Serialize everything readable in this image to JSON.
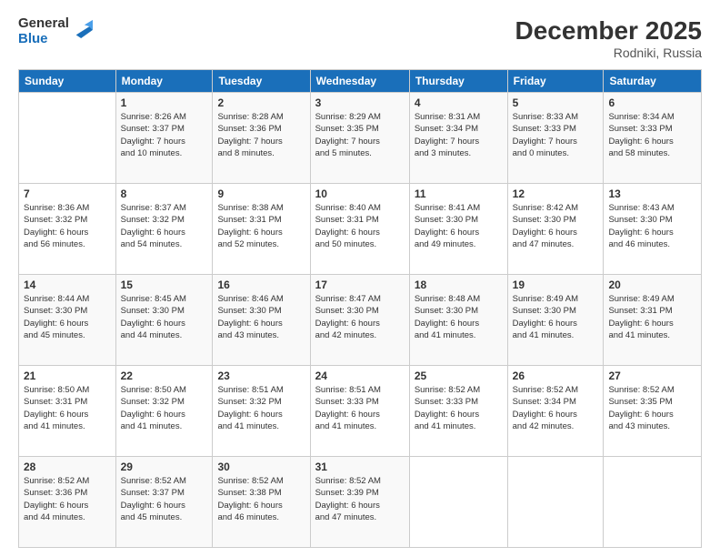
{
  "header": {
    "logo_general": "General",
    "logo_blue": "Blue",
    "month": "December 2025",
    "location": "Rodniki, Russia"
  },
  "days_of_week": [
    "Sunday",
    "Monday",
    "Tuesday",
    "Wednesday",
    "Thursday",
    "Friday",
    "Saturday"
  ],
  "weeks": [
    [
      {
        "day": "",
        "info": ""
      },
      {
        "day": "1",
        "info": "Sunrise: 8:26 AM\nSunset: 3:37 PM\nDaylight: 7 hours\nand 10 minutes."
      },
      {
        "day": "2",
        "info": "Sunrise: 8:28 AM\nSunset: 3:36 PM\nDaylight: 7 hours\nand 8 minutes."
      },
      {
        "day": "3",
        "info": "Sunrise: 8:29 AM\nSunset: 3:35 PM\nDaylight: 7 hours\nand 5 minutes."
      },
      {
        "day": "4",
        "info": "Sunrise: 8:31 AM\nSunset: 3:34 PM\nDaylight: 7 hours\nand 3 minutes."
      },
      {
        "day": "5",
        "info": "Sunrise: 8:33 AM\nSunset: 3:33 PM\nDaylight: 7 hours\nand 0 minutes."
      },
      {
        "day": "6",
        "info": "Sunrise: 8:34 AM\nSunset: 3:33 PM\nDaylight: 6 hours\nand 58 minutes."
      }
    ],
    [
      {
        "day": "7",
        "info": "Sunrise: 8:36 AM\nSunset: 3:32 PM\nDaylight: 6 hours\nand 56 minutes."
      },
      {
        "day": "8",
        "info": "Sunrise: 8:37 AM\nSunset: 3:32 PM\nDaylight: 6 hours\nand 54 minutes."
      },
      {
        "day": "9",
        "info": "Sunrise: 8:38 AM\nSunset: 3:31 PM\nDaylight: 6 hours\nand 52 minutes."
      },
      {
        "day": "10",
        "info": "Sunrise: 8:40 AM\nSunset: 3:31 PM\nDaylight: 6 hours\nand 50 minutes."
      },
      {
        "day": "11",
        "info": "Sunrise: 8:41 AM\nSunset: 3:30 PM\nDaylight: 6 hours\nand 49 minutes."
      },
      {
        "day": "12",
        "info": "Sunrise: 8:42 AM\nSunset: 3:30 PM\nDaylight: 6 hours\nand 47 minutes."
      },
      {
        "day": "13",
        "info": "Sunrise: 8:43 AM\nSunset: 3:30 PM\nDaylight: 6 hours\nand 46 minutes."
      }
    ],
    [
      {
        "day": "14",
        "info": "Sunrise: 8:44 AM\nSunset: 3:30 PM\nDaylight: 6 hours\nand 45 minutes."
      },
      {
        "day": "15",
        "info": "Sunrise: 8:45 AM\nSunset: 3:30 PM\nDaylight: 6 hours\nand 44 minutes."
      },
      {
        "day": "16",
        "info": "Sunrise: 8:46 AM\nSunset: 3:30 PM\nDaylight: 6 hours\nand 43 minutes."
      },
      {
        "day": "17",
        "info": "Sunrise: 8:47 AM\nSunset: 3:30 PM\nDaylight: 6 hours\nand 42 minutes."
      },
      {
        "day": "18",
        "info": "Sunrise: 8:48 AM\nSunset: 3:30 PM\nDaylight: 6 hours\nand 41 minutes."
      },
      {
        "day": "19",
        "info": "Sunrise: 8:49 AM\nSunset: 3:30 PM\nDaylight: 6 hours\nand 41 minutes."
      },
      {
        "day": "20",
        "info": "Sunrise: 8:49 AM\nSunset: 3:31 PM\nDaylight: 6 hours\nand 41 minutes."
      }
    ],
    [
      {
        "day": "21",
        "info": "Sunrise: 8:50 AM\nSunset: 3:31 PM\nDaylight: 6 hours\nand 41 minutes."
      },
      {
        "day": "22",
        "info": "Sunrise: 8:50 AM\nSunset: 3:32 PM\nDaylight: 6 hours\nand 41 minutes."
      },
      {
        "day": "23",
        "info": "Sunrise: 8:51 AM\nSunset: 3:32 PM\nDaylight: 6 hours\nand 41 minutes."
      },
      {
        "day": "24",
        "info": "Sunrise: 8:51 AM\nSunset: 3:33 PM\nDaylight: 6 hours\nand 41 minutes."
      },
      {
        "day": "25",
        "info": "Sunrise: 8:52 AM\nSunset: 3:33 PM\nDaylight: 6 hours\nand 41 minutes."
      },
      {
        "day": "26",
        "info": "Sunrise: 8:52 AM\nSunset: 3:34 PM\nDaylight: 6 hours\nand 42 minutes."
      },
      {
        "day": "27",
        "info": "Sunrise: 8:52 AM\nSunset: 3:35 PM\nDaylight: 6 hours\nand 43 minutes."
      }
    ],
    [
      {
        "day": "28",
        "info": "Sunrise: 8:52 AM\nSunset: 3:36 PM\nDaylight: 6 hours\nand 44 minutes."
      },
      {
        "day": "29",
        "info": "Sunrise: 8:52 AM\nSunset: 3:37 PM\nDaylight: 6 hours\nand 45 minutes."
      },
      {
        "day": "30",
        "info": "Sunrise: 8:52 AM\nSunset: 3:38 PM\nDaylight: 6 hours\nand 46 minutes."
      },
      {
        "day": "31",
        "info": "Sunrise: 8:52 AM\nSunset: 3:39 PM\nDaylight: 6 hours\nand 47 minutes."
      },
      {
        "day": "",
        "info": ""
      },
      {
        "day": "",
        "info": ""
      },
      {
        "day": "",
        "info": ""
      }
    ]
  ]
}
